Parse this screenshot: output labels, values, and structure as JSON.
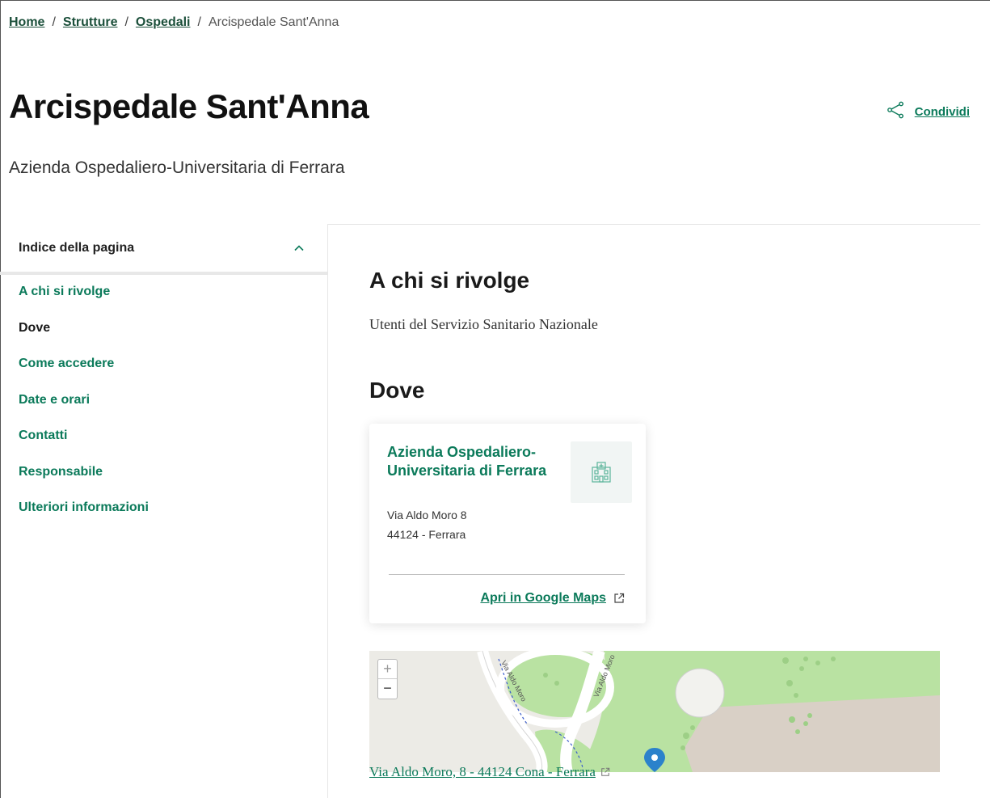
{
  "breadcrumb": {
    "items": [
      "Home",
      "Strutture",
      "Ospedali"
    ],
    "separator": "/",
    "current": "Arcispedale Sant'Anna"
  },
  "page": {
    "title": "Arcispedale Sant'Anna",
    "subtitle": "Azienda Ospedaliero-Universitaria di Ferrara"
  },
  "share": {
    "label": "Condividi",
    "icon": "share-icon"
  },
  "toc": {
    "title": "Indice della pagina",
    "items": [
      {
        "label": "A chi si rivolge",
        "active": false
      },
      {
        "label": "Dove",
        "active": true
      },
      {
        "label": "Come accedere",
        "active": false
      },
      {
        "label": "Date e orari",
        "active": false
      },
      {
        "label": "Contatti",
        "active": false
      },
      {
        "label": "Responsabile",
        "active": false
      },
      {
        "label": "Ulteriori informazioni",
        "active": false
      }
    ]
  },
  "sections": {
    "a_chi": {
      "heading": "A chi si rivolge",
      "text": "Utenti del Servizio Sanitario Nazionale"
    },
    "dove": {
      "heading": "Dove"
    }
  },
  "card": {
    "title": "Azienda Ospedaliero-Universitaria di Ferrara",
    "address_line1": "Via Aldo Moro 8",
    "address_line2": "44124 - Ferrara",
    "link_label": "Apri in Google Maps",
    "icon": "hospital-icon"
  },
  "map": {
    "zoom_in": "+",
    "zoom_out": "−",
    "caption": "Via Aldo Moro, 8 - 44124 Cona - Ferrara",
    "road_labels": [
      "Via Aldo Moro",
      "Via Aldo Moro"
    ]
  },
  "colors": {
    "accent": "#0b7a5a",
    "breadcrumb_link": "#1b4f3a",
    "map_grass": "#b9e2a2",
    "map_building": "#d9d0c6",
    "map_marker": "#2b82cb"
  }
}
